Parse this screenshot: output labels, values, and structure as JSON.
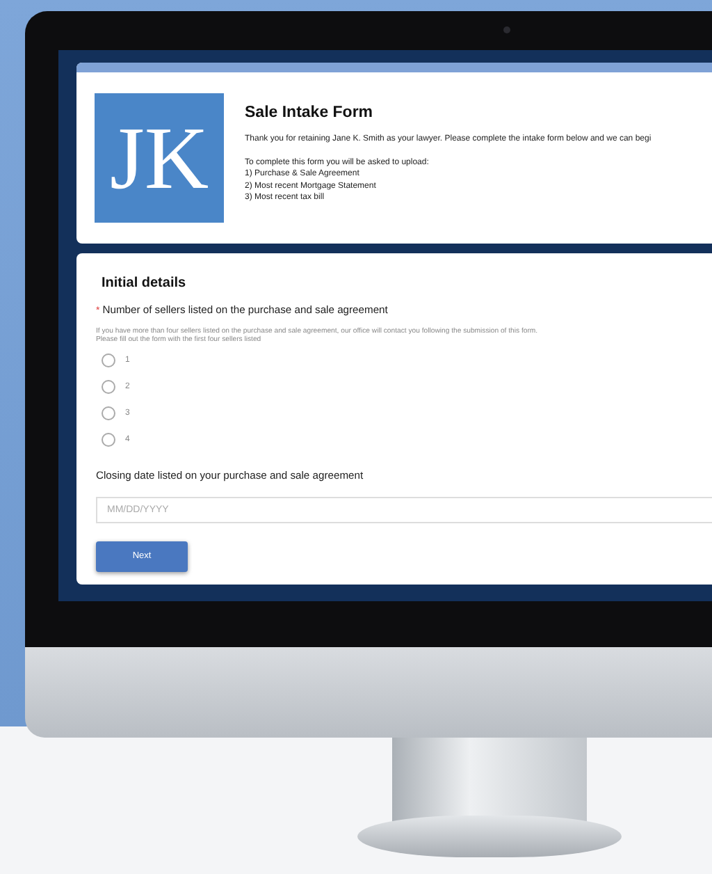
{
  "form": {
    "logo": "JK",
    "title": "Sale Intake Form",
    "intro": "Thank you for retaining Jane K. Smith as your lawyer. Please complete the intake form below and we can begi",
    "upload_heading": "To complete this form you will be asked to upload:",
    "uploads": [
      "1) Purchase & Sale Agreement",
      "2) Most recent Mortgage Statement",
      "3) Most recent tax bill"
    ]
  },
  "section": {
    "title": "Initial details",
    "questions": [
      {
        "kind": "radio",
        "required_mark": "*",
        "label": "Number of sellers listed on the purchase and sale agreement",
        "help": [
          "If you have more than four sellers listed on the purchase and sale agreement, our office will contact you following the submission of this form.",
          "Please fill out the form with the first four sellers listed"
        ],
        "options": [
          {
            "label": "1",
            "selected": false
          },
          {
            "label": "2",
            "selected": false
          },
          {
            "label": "3",
            "selected": false
          },
          {
            "label": "4",
            "selected": false
          }
        ]
      },
      {
        "kind": "date",
        "label": "Closing date listed on your purchase and sale agreement",
        "placeholder": "MM/DD/YYYY"
      }
    ]
  },
  "buttons": [
    {
      "label": "Next"
    }
  ]
}
